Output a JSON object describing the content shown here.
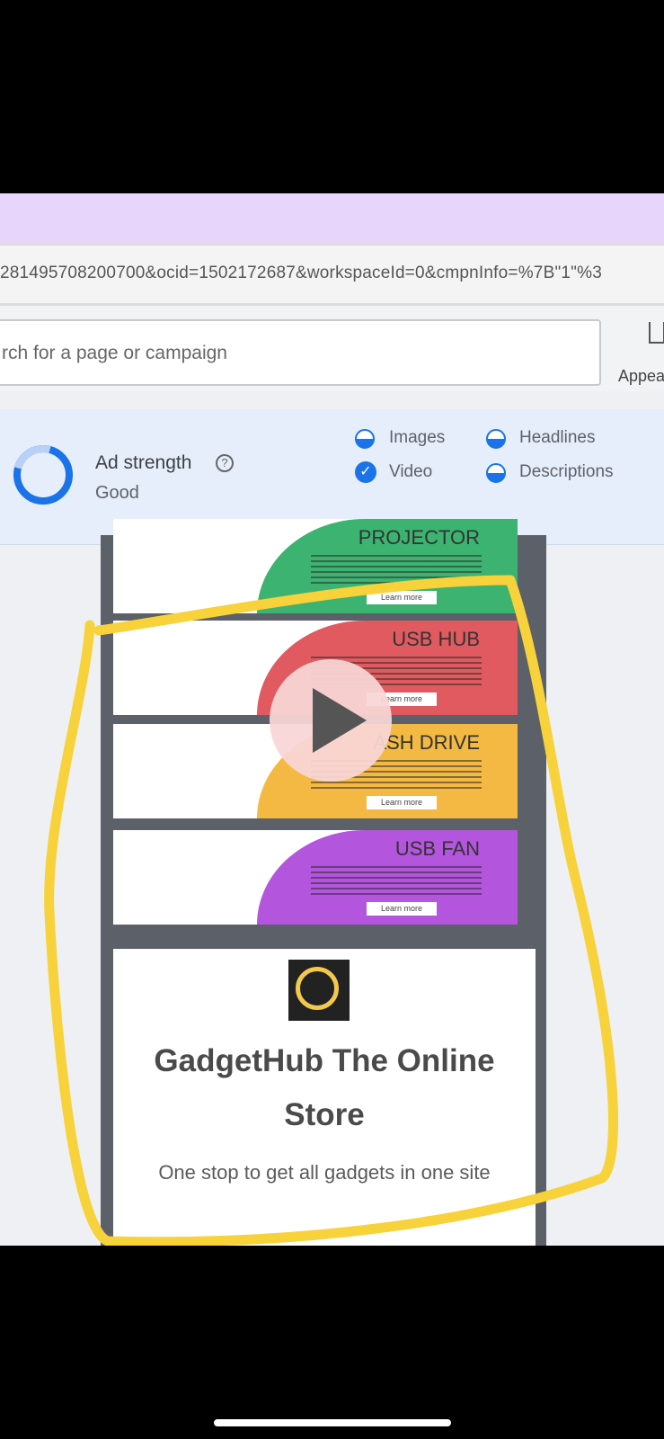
{
  "browser": {
    "url": "281495708200700&ocid=1502172687&workspaceId=0&cmpnInfo=%7B\"1\"%3"
  },
  "header": {
    "search_placeholder": "rch for a page or campaign",
    "appearance_label": "Appea"
  },
  "ad_strength": {
    "title": "Ad strength",
    "value": "Good",
    "criteria": [
      {
        "label": "Images",
        "status": "partial"
      },
      {
        "label": "Headlines",
        "status": "partial"
      },
      {
        "label": "Video",
        "status": "complete"
      },
      {
        "label": "Descriptions",
        "status": "partial"
      }
    ]
  },
  "preview": {
    "banners": [
      {
        "name": "PROJECTOR",
        "color": "#3cb371",
        "button": "Learn more"
      },
      {
        "name": "USB HUB",
        "color": "#e05a5f",
        "button": "Learn more"
      },
      {
        "name": "ASH DRIVE",
        "color": "#f4b942",
        "button": "Learn more"
      },
      {
        "name": "USB FAN",
        "color": "#b455dd",
        "button": "Learn more"
      }
    ],
    "brand_name": "GadgetHub The Online Store",
    "tagline": "One stop to get all gadgets in one site"
  },
  "colors": {
    "accent": "#1a73e8",
    "annotation": "#f7d23a"
  }
}
